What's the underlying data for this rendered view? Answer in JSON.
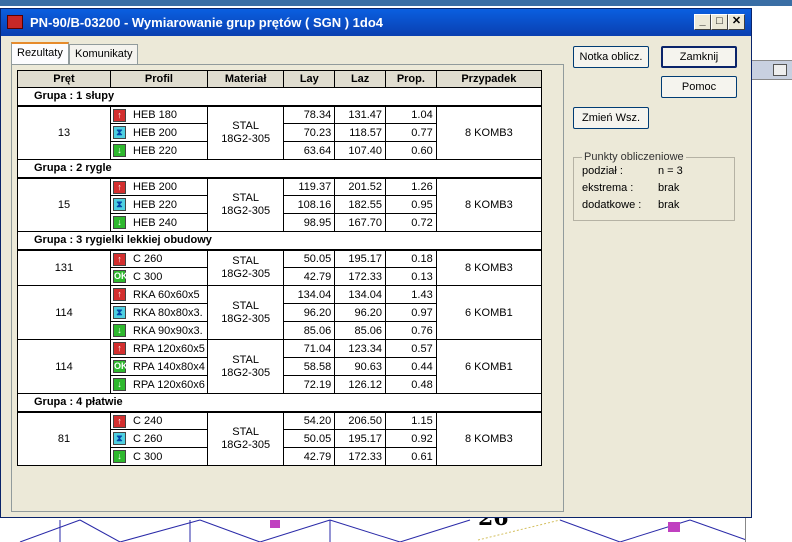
{
  "window": {
    "title": "PN-90/B-03200 - Wymiarowanie grup prętów ( SGN ) 1do4",
    "minimize": "_",
    "maximize": "□",
    "close": "✕"
  },
  "tabs": [
    {
      "label": "Rezultaty"
    },
    {
      "label": "Komunikaty"
    }
  ],
  "table": {
    "headers": [
      "Pręt",
      "Profil",
      "Materiał",
      "Lay",
      "Laz",
      "Prop.",
      "Przypadek"
    ],
    "groups": [
      {
        "title": "Grupa :  1  słupy",
        "blocks": [
          {
            "pret": "13",
            "mat1": "STAL",
            "mat2": "18G2-305",
            "przypadek": "8 KOMB3",
            "rows": [
              {
                "icon": "arrow-up-icon",
                "sym": "↑",
                "cls": "red",
                "profil": "HEB 180",
                "lay": "78.34",
                "laz": "131.47",
                "prop": "1.04"
              },
              {
                "icon": "hourglass-icon",
                "sym": "⧗",
                "cls": "cyan",
                "profil": "HEB 200",
                "lay": "70.23",
                "laz": "118.57",
                "prop": "0.77"
              },
              {
                "icon": "arrow-down-icon",
                "sym": "↓",
                "cls": "green",
                "profil": "HEB 220",
                "lay": "63.64",
                "laz": "107.40",
                "prop": "0.60"
              }
            ]
          }
        ]
      },
      {
        "title": "Grupa :  2  rygle",
        "blocks": [
          {
            "pret": "15",
            "mat1": "STAL",
            "mat2": "18G2-305",
            "przypadek": "8 KOMB3",
            "rows": [
              {
                "icon": "arrow-up-icon",
                "sym": "↑",
                "cls": "red",
                "profil": "HEB 200",
                "lay": "119.37",
                "laz": "201.52",
                "prop": "1.26"
              },
              {
                "icon": "hourglass-icon",
                "sym": "⧗",
                "cls": "cyan",
                "profil": "HEB 220",
                "lay": "108.16",
                "laz": "182.55",
                "prop": "0.95"
              },
              {
                "icon": "arrow-down-icon",
                "sym": "↓",
                "cls": "green",
                "profil": "HEB 240",
                "lay": "98.95",
                "laz": "167.70",
                "prop": "0.72"
              }
            ]
          }
        ]
      },
      {
        "title": "Grupa :  3  rygielki lekkiej obudowy",
        "blocks": [
          {
            "pret": "131",
            "mat1": "STAL",
            "mat2": "18G2-305",
            "przypadek": "8 KOMB3",
            "rows": [
              {
                "icon": "arrow-up-icon",
                "sym": "↑",
                "cls": "red",
                "profil": "C 260",
                "lay": "50.05",
                "laz": "195.17",
                "prop": "0.18"
              },
              {
                "icon": "ok-icon",
                "sym": "OK",
                "cls": "green",
                "profil": "C 300",
                "lay": "42.79",
                "laz": "172.33",
                "prop": "0.13"
              }
            ]
          },
          {
            "pret": "114",
            "mat1": "STAL",
            "mat2": "18G2-305",
            "przypadek": "6 KOMB1",
            "rows": [
              {
                "icon": "arrow-up-icon",
                "sym": "↑",
                "cls": "red",
                "profil": "RKA 60x60x5",
                "lay": "134.04",
                "laz": "134.04",
                "prop": "1.43"
              },
              {
                "icon": "hourglass-icon",
                "sym": "⧗",
                "cls": "cyan",
                "profil": "RKA 80x80x3.",
                "lay": "96.20",
                "laz": "96.20",
                "prop": "0.97"
              },
              {
                "icon": "arrow-down-icon",
                "sym": "↓",
                "cls": "green",
                "profil": "RKA 90x90x3.",
                "lay": "85.06",
                "laz": "85.06",
                "prop": "0.76"
              }
            ]
          },
          {
            "pret": "114",
            "mat1": "STAL",
            "mat2": "18G2-305",
            "przypadek": "6 KOMB1",
            "rows": [
              {
                "icon": "arrow-up-icon",
                "sym": "↑",
                "cls": "red",
                "profil": "RPA 120x60x5",
                "lay": "71.04",
                "laz": "123.34",
                "prop": "0.57"
              },
              {
                "icon": "ok-icon",
                "sym": "OK",
                "cls": "green",
                "profil": "RPA 140x80x4",
                "lay": "58.58",
                "laz": "90.63",
                "prop": "0.44"
              },
              {
                "icon": "arrow-down-icon",
                "sym": "↓",
                "cls": "green",
                "profil": "RPA 120x60x6",
                "lay": "72.19",
                "laz": "126.12",
                "prop": "0.48"
              }
            ]
          }
        ]
      },
      {
        "title": "Grupa :  4  płatwie",
        "blocks": [
          {
            "pret": "81",
            "mat1": "STAL",
            "mat2": "18G2-305",
            "przypadek": "8 KOMB3",
            "rows": [
              {
                "icon": "arrow-up-icon",
                "sym": "↑",
                "cls": "red",
                "profil": "C 240",
                "lay": "54.20",
                "laz": "206.50",
                "prop": "1.15"
              },
              {
                "icon": "hourglass-icon",
                "sym": "⧗",
                "cls": "cyan",
                "profil": "C 260",
                "lay": "50.05",
                "laz": "195.17",
                "prop": "0.92"
              },
              {
                "icon": "arrow-down-icon",
                "sym": "↓",
                "cls": "green",
                "profil": "C 300",
                "lay": "42.79",
                "laz": "172.33",
                "prop": "0.61"
              }
            ]
          }
        ]
      }
    ]
  },
  "buttons": {
    "notka": "Notka oblicz.",
    "zamknij": "Zamknij",
    "pomoc": "Pomoc",
    "zmien": "Zmień Wsz."
  },
  "punkty": {
    "legend": "Punkty obliczeniowe",
    "rows": [
      {
        "label": "podział :",
        "value": "n = 3"
      },
      {
        "label": "ekstrema :",
        "value": "brak"
      },
      {
        "label": "dodatkowe :",
        "value": "brak"
      }
    ]
  },
  "background": {
    "label": "26"
  }
}
